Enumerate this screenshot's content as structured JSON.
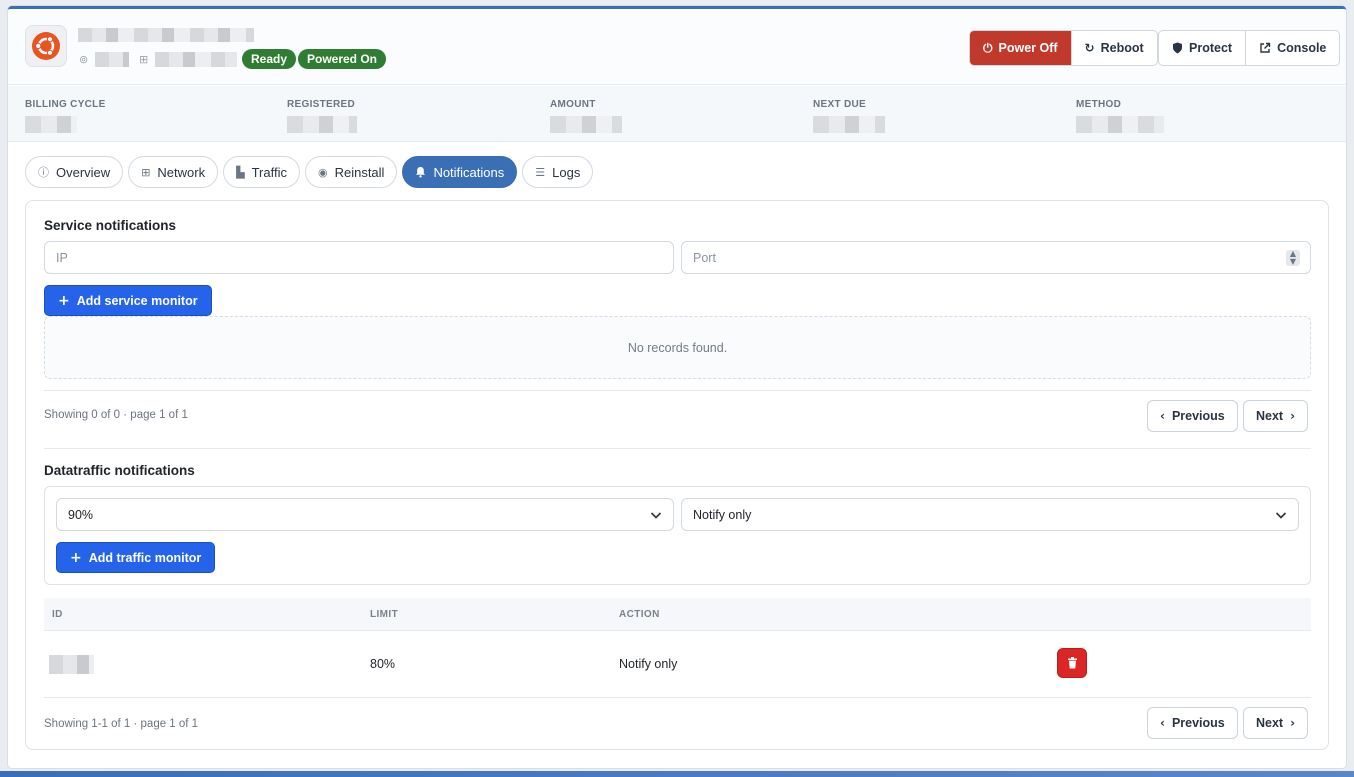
{
  "header": {
    "status_badges": [
      "Ready",
      "Powered On"
    ],
    "actions": {
      "power_off": "Power Off",
      "reboot": "Reboot",
      "protect": "Protect",
      "console": "Console"
    }
  },
  "billing": {
    "billing_cycle": "BILLING CYCLE",
    "registered": "REGISTERED",
    "amount": "AMOUNT",
    "next_due": "NEXT DUE",
    "method": "METHOD"
  },
  "tabs": [
    "Overview",
    "Network",
    "Traffic",
    "Reinstall",
    "Notifications",
    "Logs"
  ],
  "active_tab": "Notifications",
  "service": {
    "title": "Service notifications",
    "ip_placeholder": "IP",
    "port_placeholder": "Port",
    "add_label": "Add service monitor",
    "empty_text": "No records found.",
    "showing": "Showing 0 of 0 · page 1 of 1",
    "prev": "Previous",
    "next": "Next"
  },
  "traffic": {
    "title": "Datatraffic notifications",
    "limit_value": "90%",
    "action_value": "Notify only",
    "add_label": "Add traffic monitor",
    "columns": {
      "id": "ID",
      "limit": "LIMIT",
      "action": "ACTION"
    },
    "rows": [
      {
        "limit": "80%",
        "action": "Notify only"
      }
    ],
    "showing": "Showing 1-1 of 1 · page 1 of 1",
    "prev": "Previous",
    "next": "Next"
  },
  "colors": {
    "accent": "#3a6fb6",
    "primary_button": "#2563eb",
    "danger": "#c0392b",
    "success": "#2e7d32",
    "delete": "#dc2626"
  }
}
